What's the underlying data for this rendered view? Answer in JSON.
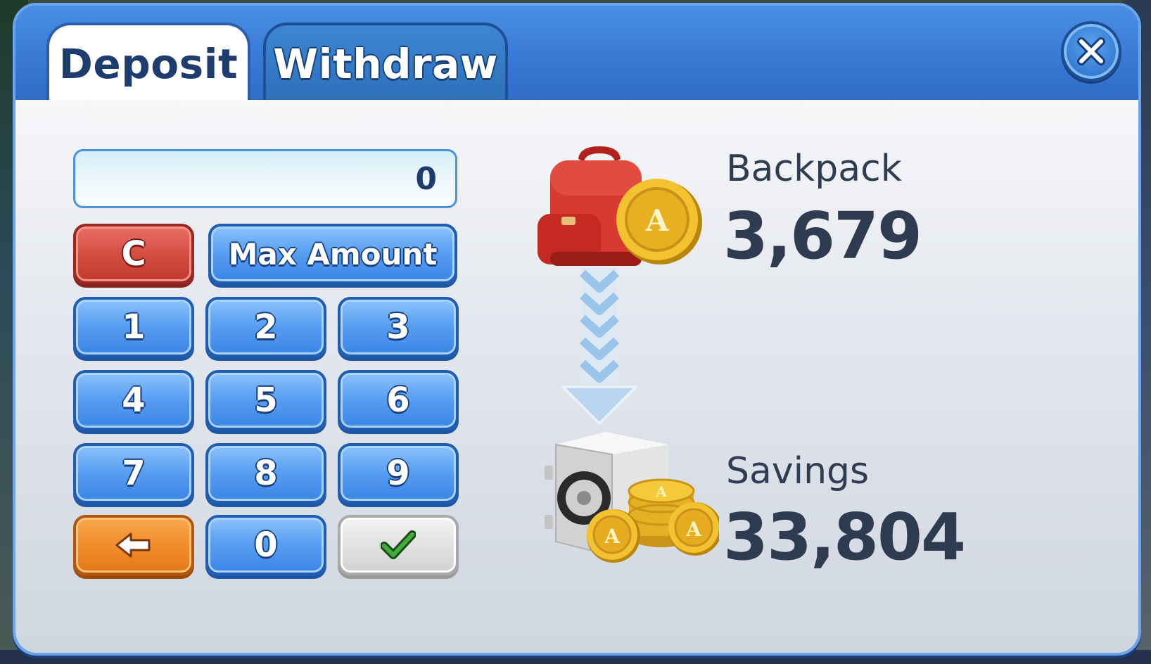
{
  "tabs": [
    {
      "label": "Deposit",
      "active": true
    },
    {
      "label": "Withdraw",
      "active": false
    }
  ],
  "close_icon": "close-icon",
  "amount_field": {
    "value": "0"
  },
  "keypad": {
    "clear": "C",
    "max": "Max Amount",
    "digits": [
      "1",
      "2",
      "3",
      "4",
      "5",
      "6",
      "7",
      "8",
      "9",
      "0"
    ],
    "back_icon": "back-arrow-icon",
    "confirm_icon": "checkmark-icon"
  },
  "backpack": {
    "label": "Backpack",
    "value": "3,679",
    "icon": "backpack-coin-icon"
  },
  "savings": {
    "label": "Savings",
    "value": "33,804",
    "icon": "safe-coins-icon"
  },
  "transfer_icon": "down-arrow-icon",
  "colors": {
    "header_blue": "#3a7bd6",
    "key_blue": "#5aa0f2",
    "key_red": "#d44a3f",
    "key_orange": "#f08a2a",
    "text_dark": "#2f3d52",
    "coin_gold": "#f4c430"
  }
}
